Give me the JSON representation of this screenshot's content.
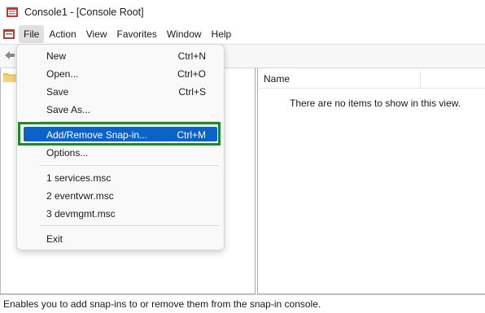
{
  "window": {
    "title": "Console1 - [Console Root]"
  },
  "menubar": {
    "items": [
      {
        "label": "File",
        "active": true
      },
      {
        "label": "Action"
      },
      {
        "label": "View"
      },
      {
        "label": "Favorites"
      },
      {
        "label": "Window"
      },
      {
        "label": "Help"
      }
    ]
  },
  "file_menu": {
    "items": [
      {
        "label": "New",
        "shortcut": "Ctrl+N"
      },
      {
        "label": "Open...",
        "shortcut": "Ctrl+O"
      },
      {
        "label": "Save",
        "shortcut": "Ctrl+S"
      },
      {
        "label": "Save As...",
        "shortcut": ""
      },
      {
        "label": "Add/Remove Snap-in...",
        "shortcut": "Ctrl+M",
        "highlighted": true
      },
      {
        "label": "Options...",
        "shortcut": ""
      },
      {
        "label": "1 services.msc",
        "shortcut": ""
      },
      {
        "label": "2 eventvwr.msc",
        "shortcut": ""
      },
      {
        "label": "3 devmgmt.msc",
        "shortcut": ""
      },
      {
        "label": "Exit",
        "shortcut": ""
      }
    ]
  },
  "right_pane": {
    "column_header": "Name",
    "empty_message": "There are no items to show in this view."
  },
  "statusbar": {
    "text": "Enables you to add snap-ins to or remove them from the snap-in console."
  },
  "colors": {
    "highlight": "#0a63c9",
    "annotation_box": "#1b8a2b"
  },
  "icons": {
    "app": "mmc-console-icon",
    "document": "console-document-icon",
    "back": "back-arrow-icon",
    "tree": "folder-icon"
  }
}
